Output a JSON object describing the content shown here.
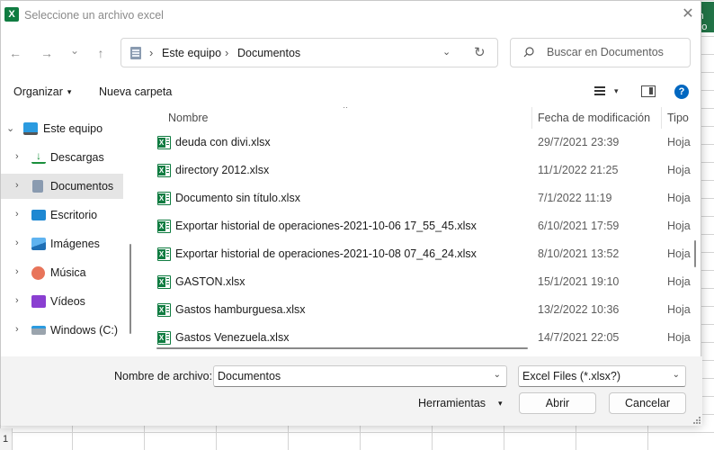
{
  "window": {
    "title": "Seleccione un archivo excel",
    "app_icon_letter": "X",
    "close_glyph": "✕"
  },
  "background": {
    "excel_tab_text": "sm ado",
    "row_number": "1"
  },
  "nav": {
    "back_glyph": "←",
    "forward_glyph": "→",
    "recent_glyph": "⌄",
    "up_glyph": "↑"
  },
  "address": {
    "crumbs": [
      "Este equipo",
      "Documentos"
    ],
    "separator": "›",
    "dropdown_glyph": "⌄",
    "refresh_glyph": "↻"
  },
  "search": {
    "placeholder": "Buscar en Documentos"
  },
  "toolbar": {
    "organize_label": "Organizar",
    "new_folder_label": "Nueva carpeta",
    "help_glyph": "?"
  },
  "sidebar": {
    "items": [
      {
        "label": "Este equipo",
        "icon": "computer-icon",
        "expanded": true
      },
      {
        "label": "Descargas",
        "icon": "download-icon"
      },
      {
        "label": "Documentos",
        "icon": "documents-icon",
        "selected": true
      },
      {
        "label": "Escritorio",
        "icon": "desktop-icon"
      },
      {
        "label": "Imágenes",
        "icon": "pictures-icon"
      },
      {
        "label": "Música",
        "icon": "music-icon"
      },
      {
        "label": "Vídeos",
        "icon": "videos-icon"
      },
      {
        "label": "Windows (C:)",
        "icon": "drive-icon"
      }
    ],
    "expand_glyph": "⌄",
    "collapse_glyph": "›"
  },
  "filelist": {
    "columns": [
      "Nombre",
      "Fecha de modificación",
      "Tipo"
    ],
    "sort_glyph": "^",
    "rows": [
      {
        "name": "deuda con divi.xlsx",
        "date": "29/7/2021 23:39",
        "type": "Hoja"
      },
      {
        "name": "directory 2012.xlsx",
        "date": "11/1/2022 21:25",
        "type": "Hoja"
      },
      {
        "name": "Documento sin título.xlsx",
        "date": "7/1/2022 11:19",
        "type": "Hoja"
      },
      {
        "name": "Exportar historial de operaciones-2021-10-06 17_55_45.xlsx",
        "date": "6/10/2021 17:59",
        "type": "Hoja"
      },
      {
        "name": "Exportar historial de operaciones-2021-10-08 07_46_24.xlsx",
        "date": "8/10/2021 13:52",
        "type": "Hoja"
      },
      {
        "name": "GASTON.xlsx",
        "date": "15/1/2021 19:10",
        "type": "Hoja"
      },
      {
        "name": "Gastos hamburguesa.xlsx",
        "date": "13/2/2022 10:36",
        "type": "Hoja"
      },
      {
        "name": "Gastos Venezuela.xlsx",
        "date": "14/7/2021 22:05",
        "type": "Hoja"
      }
    ]
  },
  "footer": {
    "filename_label": "Nombre de archivo:",
    "filename_value": "Documentos",
    "filter_value": "Excel Files (*.xlsx?)",
    "tools_label": "Herramientas",
    "open_label": "Abrir",
    "cancel_label": "Cancelar",
    "caret_glyph": "▾",
    "combo_glyph": "⌄"
  },
  "colors": {
    "excel_green": "#107c41",
    "selection_gray": "#e5e5e5",
    "help_blue": "#0067c0",
    "footer_bg": "#f3f3f3"
  }
}
